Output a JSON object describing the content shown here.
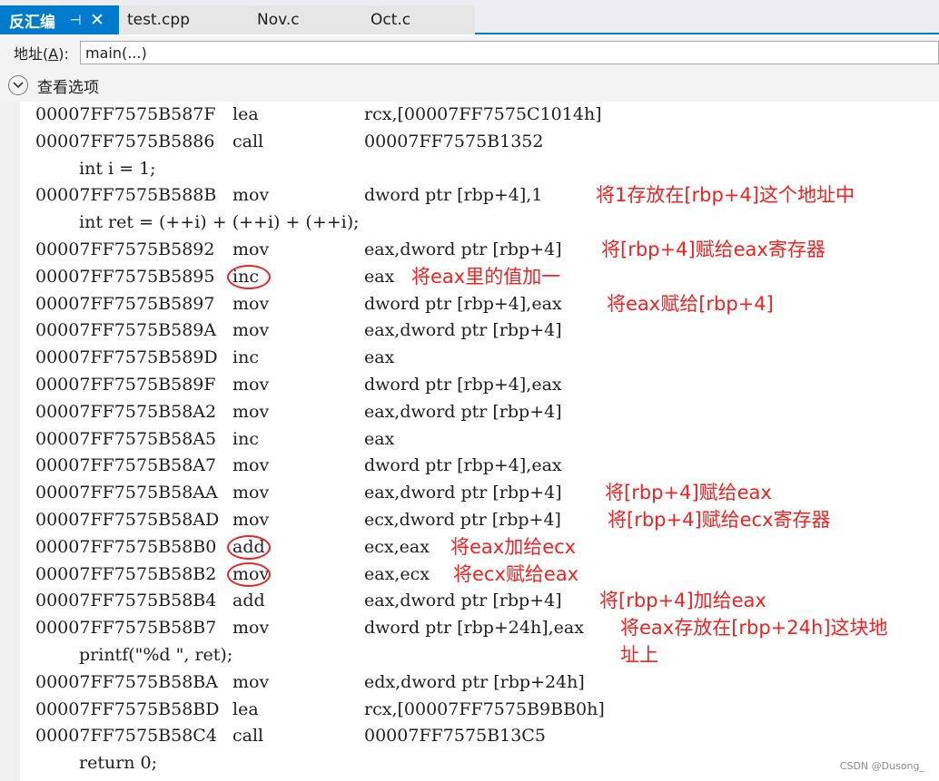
{
  "tabs": {
    "active": "反汇编",
    "pin_icon": "⊣",
    "close_icon": "✕",
    "others": [
      "test.cpp",
      "Nov.c",
      "Oct.c"
    ]
  },
  "address": {
    "label_prefix": "地址(",
    "label_key": "A",
    "label_suffix": "):",
    "value": "main(...)"
  },
  "view_options": {
    "label": "查看选项",
    "icon": "chevron-down-icon"
  },
  "lines": [
    {
      "addr": "00007FF7575B587F",
      "op": "lea",
      "arg": "rcx,[00007FF7575C1014h]"
    },
    {
      "addr": "00007FF7575B5886",
      "op": "call",
      "arg": "00007FF7575B1352"
    },
    {
      "src": "int i = 1;"
    },
    {
      "addr": "00007FF7575B588B",
      "op": "mov",
      "arg": "dword ptr [rbp+4],1",
      "note": "将1存放在[rbp+4]这个地址中"
    },
    {
      "src": "int ret = (++i) + (++i) + (++i);"
    },
    {
      "addr": "00007FF7575B5892",
      "op": "mov",
      "arg": "eax,dword ptr [rbp+4]",
      "note": "将[rbp+4]赋给eax寄存器"
    },
    {
      "addr": "00007FF7575B5895",
      "op": "inc",
      "arg": "eax",
      "note": "将eax里的值加一",
      "circled": true
    },
    {
      "addr": "00007FF7575B5897",
      "op": "mov",
      "arg": "dword ptr [rbp+4],eax",
      "note": "将eax赋给[rbp+4]"
    },
    {
      "addr": "00007FF7575B589A",
      "op": "mov",
      "arg": "eax,dword ptr [rbp+4]"
    },
    {
      "addr": "00007FF7575B589D",
      "op": "inc",
      "arg": "eax"
    },
    {
      "addr": "00007FF7575B589F",
      "op": "mov",
      "arg": "dword ptr [rbp+4],eax"
    },
    {
      "addr": "00007FF7575B58A2",
      "op": "mov",
      "arg": "eax,dword ptr [rbp+4]"
    },
    {
      "addr": "00007FF7575B58A5",
      "op": "inc",
      "arg": "eax"
    },
    {
      "addr": "00007FF7575B58A7",
      "op": "mov",
      "arg": "dword ptr [rbp+4],eax"
    },
    {
      "addr": "00007FF7575B58AA",
      "op": "mov",
      "arg": "eax,dword ptr [rbp+4]",
      "note": "将[rbp+4]赋给eax"
    },
    {
      "addr": "00007FF7575B58AD",
      "op": "mov",
      "arg": "ecx,dword ptr [rbp+4]",
      "note": "将[rbp+4]赋给ecx寄存器"
    },
    {
      "addr": "00007FF7575B58B0",
      "op": "add",
      "arg": "ecx,eax",
      "note": "将eax加给ecx",
      "circled": true
    },
    {
      "addr": "00007FF7575B58B2",
      "op": "mov",
      "arg": "eax,ecx",
      "note": "将ecx赋给eax",
      "circled": true
    },
    {
      "addr": "00007FF7575B58B4",
      "op": "add",
      "arg": "eax,dword ptr [rbp+4]",
      "note": "将[rbp+4]加给eax"
    },
    {
      "addr": "00007FF7575B58B7",
      "op": "mov",
      "arg": "dword ptr [rbp+24h],eax",
      "note": "将eax存放在[rbp+24h]这块地",
      "note2": "址上"
    },
    {
      "src": "printf(\"%d \", ret);"
    },
    {
      "addr": "00007FF7575B58BA",
      "op": "mov",
      "arg": "edx,dword ptr [rbp+24h]"
    },
    {
      "addr": "00007FF7575B58BD",
      "op": "lea",
      "arg": "rcx,[00007FF7575B9BB0h]"
    },
    {
      "addr": "00007FF7575B58C4",
      "op": "call",
      "arg": "00007FF7575B13C5"
    },
    {
      "src": "return 0;"
    }
  ],
  "watermark": "CSDN @Dusong_"
}
